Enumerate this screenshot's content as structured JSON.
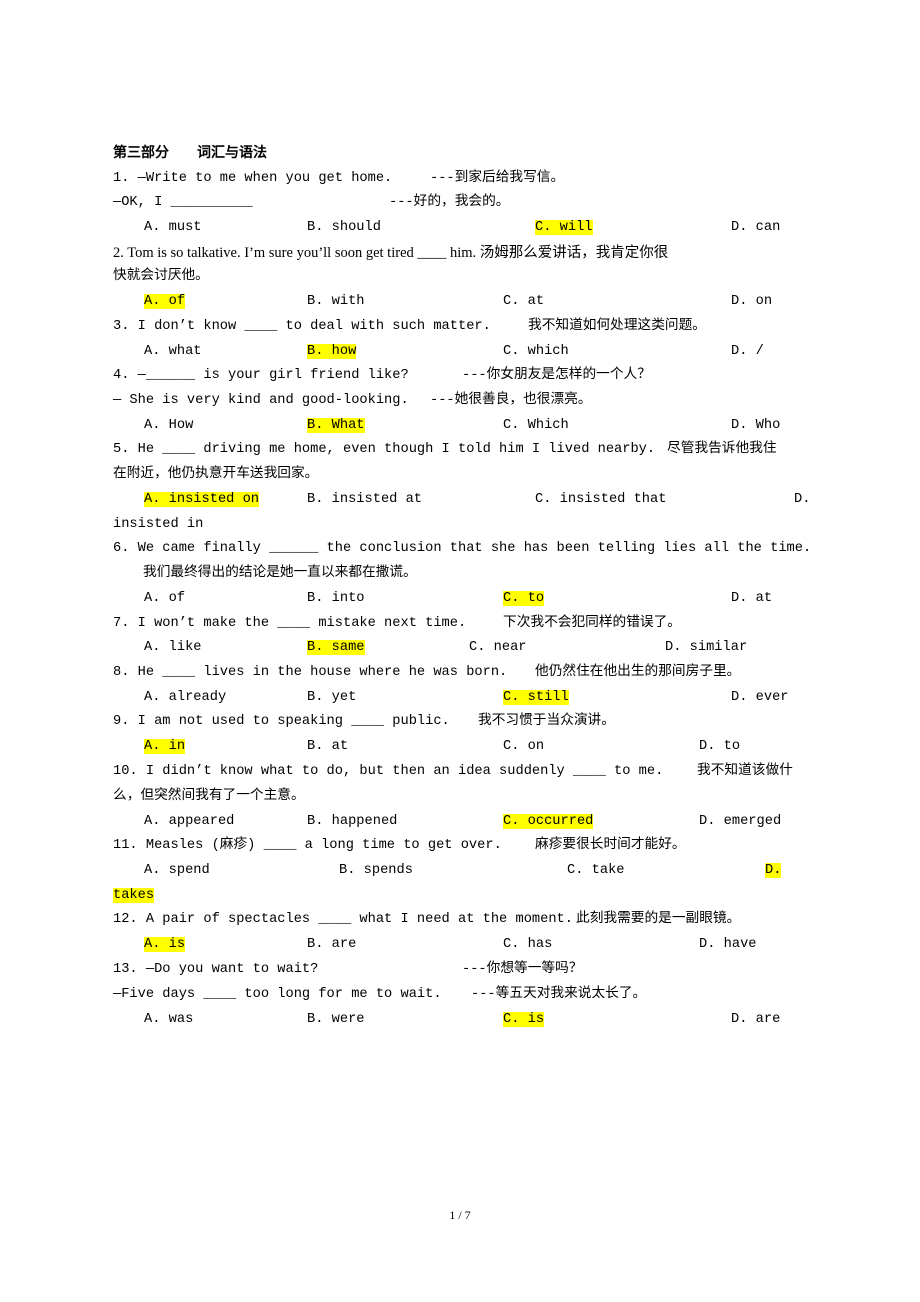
{
  "section_title": "第三部分　　词汇与语法",
  "highlight_color": "#ffff00",
  "questions": [
    {
      "lines": [
        {
          "en": "1. —Write to me when you get home.",
          "cn": "---到家后给我写信。"
        },
        {
          "en": "—OK, I __________",
          "cn": "---好的，我会的。"
        }
      ],
      "options": [
        {
          "label": "A.",
          "text": "must"
        },
        {
          "label": "B.",
          "text": "should"
        },
        {
          "label": "C.",
          "text": "will",
          "correct": true
        },
        {
          "label": "D.",
          "text": "can"
        }
      ]
    },
    {
      "lines": [
        {
          "en": "2. Tom is so talkative. I’m sure you’ll soon get tired ____ him. 汤姆那么爱讲话，我肯定你很",
          "cn": ""
        },
        {
          "en": "快就会讨厌他。",
          "cn": ""
        }
      ],
      "options": [
        {
          "label": "A.",
          "text": "of",
          "correct": true
        },
        {
          "label": "B.",
          "text": "with"
        },
        {
          "label": "C.",
          "text": "at"
        },
        {
          "label": "D.",
          "text": "on"
        }
      ]
    },
    {
      "lines": [
        {
          "en": "3. I don’t know ____ to deal with such matter.",
          "cn": "我不知道如何处理这类问题。"
        }
      ],
      "options": [
        {
          "label": "A.",
          "text": "what"
        },
        {
          "label": "B.",
          "text": "how",
          "correct": true
        },
        {
          "label": "C.",
          "text": "which"
        },
        {
          "label": "D.",
          "text": "/"
        }
      ]
    },
    {
      "lines": [
        {
          "en": "4. —______ is your girl friend like?",
          "cn": "---你女朋友是怎样的一个人？"
        },
        {
          "en": "— She is very kind and good-looking.",
          "cn": "---她很善良，也很漂亮。"
        }
      ],
      "options": [
        {
          "label": "A.",
          "text": "How"
        },
        {
          "label": "B.",
          "text": "What",
          "correct": true
        },
        {
          "label": "C.",
          "text": "Which"
        },
        {
          "label": "D.",
          "text": "Who"
        }
      ]
    },
    {
      "lines": [
        {
          "en": "5. He ____ driving me home, even though I told him I lived nearby.",
          "cn": "尽管我告诉他我住"
        },
        {
          "en": "在附近，他仍执意开车送我回家。",
          "cn": ""
        }
      ],
      "options": [
        {
          "label": "A.",
          "text": "insisted on",
          "correct": true
        },
        {
          "label": "B.",
          "text": "insisted at"
        },
        {
          "label": "C.",
          "text": "insisted that"
        },
        {
          "label": "D.",
          "text": "insisted in"
        }
      ]
    },
    {
      "lines": [
        {
          "en": "6. We came finally ______ the conclusion that she has been telling lies all the time.",
          "cn": ""
        },
        {
          "en": "",
          "cn": "我们最终得出的结论是她一直以来都在撒谎。"
        }
      ],
      "options": [
        {
          "label": "A.",
          "text": "of"
        },
        {
          "label": "B.",
          "text": "into"
        },
        {
          "label": "C.",
          "text": "to",
          "correct": true
        },
        {
          "label": "D.",
          "text": "at"
        }
      ]
    },
    {
      "lines": [
        {
          "en": "7. I won’t make the ____ mistake next time.",
          "cn": "下次我不会犯同样的错误了。"
        }
      ],
      "options": [
        {
          "label": "A.",
          "text": "like"
        },
        {
          "label": "B.",
          "text": "same",
          "correct": true
        },
        {
          "label": "C.",
          "text": "near"
        },
        {
          "label": "D.",
          "text": "similar"
        }
      ]
    },
    {
      "lines": [
        {
          "en": "8. He ____ lives in the house where he was born.",
          "cn": "他仍然住在他出生的那间房子里。"
        }
      ],
      "options": [
        {
          "label": "A.",
          "text": "already"
        },
        {
          "label": "B.",
          "text": "yet"
        },
        {
          "label": "C.",
          "text": "still",
          "correct": true
        },
        {
          "label": "D.",
          "text": "ever"
        }
      ]
    },
    {
      "lines": [
        {
          "en": "9. I am not used to speaking ____ public.",
          "cn": "我不习惯于当众演讲。"
        }
      ],
      "options": [
        {
          "label": "A.",
          "text": "in",
          "correct": true
        },
        {
          "label": "B.",
          "text": "at"
        },
        {
          "label": "C.",
          "text": "on"
        },
        {
          "label": "D.",
          "text": "to"
        }
      ]
    },
    {
      "lines": [
        {
          "en": "10. I didn’t know what to do, but then an idea suddenly ____ to me.",
          "cn": "我不知道该做什"
        },
        {
          "en": "么，但突然间我有了一个主意。",
          "cn": ""
        }
      ],
      "options": [
        {
          "label": "A.",
          "text": "appeared"
        },
        {
          "label": "B.",
          "text": "happened"
        },
        {
          "label": "C.",
          "text": "occurred",
          "correct": true
        },
        {
          "label": "D.",
          "text": "emerged"
        }
      ]
    },
    {
      "lines": [
        {
          "en": "11. Measles (麻疹) ____ a long time to get over.",
          "cn": "麻疹要很长时间才能好。"
        }
      ],
      "options": [
        {
          "label": "A.",
          "text": "spend"
        },
        {
          "label": "B.",
          "text": "spends"
        },
        {
          "label": "C.",
          "text": "take"
        },
        {
          "label": "D.",
          "text": "takes",
          "correct": true
        }
      ]
    },
    {
      "lines": [
        {
          "en": "12. A pair of spectacles ____ what I need at the moment.",
          "cn": "此刻我需要的是一副眼镜。"
        }
      ],
      "options": [
        {
          "label": "A.",
          "text": "is",
          "correct": true
        },
        {
          "label": "B.",
          "text": "are"
        },
        {
          "label": "C.",
          "text": "has"
        },
        {
          "label": "D.",
          "text": "have"
        }
      ]
    },
    {
      "lines": [
        {
          "en": "13. —Do you want to wait?",
          "cn": "---你想等一等吗？"
        },
        {
          "en": "—Five days ____ too long for me to wait.",
          "cn": "---等五天对我来说太长了。"
        }
      ],
      "options": [
        {
          "label": "A.",
          "text": "was"
        },
        {
          "label": "B.",
          "text": "were"
        },
        {
          "label": "C.",
          "text": "is",
          "correct": true
        },
        {
          "label": "D.",
          "text": "are"
        }
      ]
    }
  ],
  "footer": {
    "page_indicator": "1 / 7"
  }
}
